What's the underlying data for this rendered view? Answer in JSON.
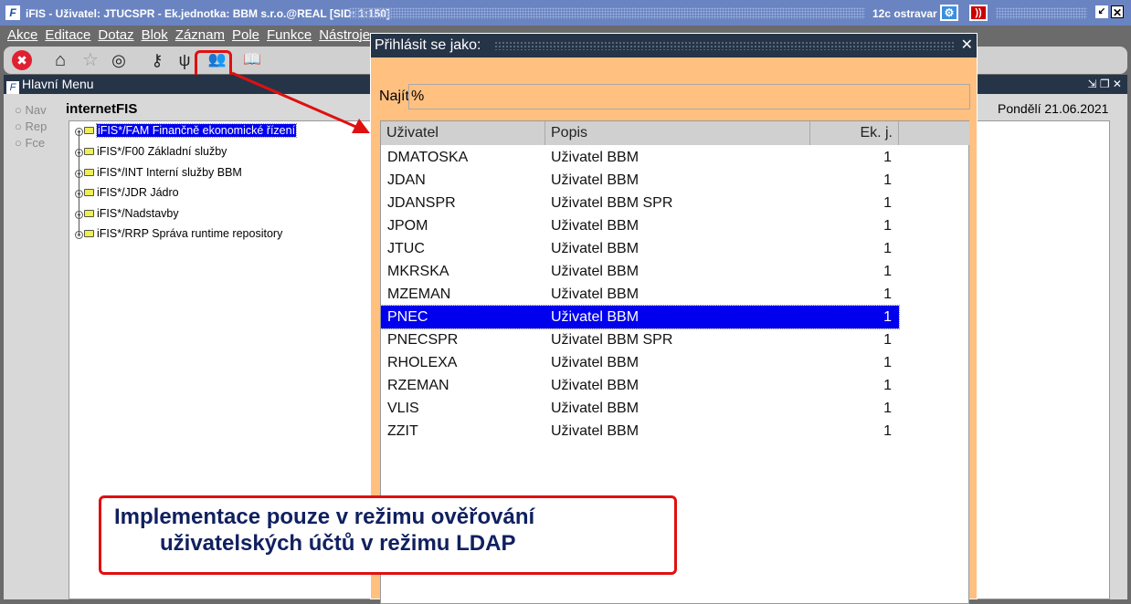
{
  "window": {
    "title": "iFIS - Uživatel: JTUCSPR - Ek.jednotka: BBM s.r.o.@REAL   [SID: 1:150]",
    "server": "12c ostravar"
  },
  "menu": [
    "Akce",
    "Editace",
    "Dotaz",
    "Blok",
    "Záznam",
    "Pole",
    "Funkce",
    "Nástroje"
  ],
  "toolbar": {
    "icons": [
      "close-icon",
      "home-icon",
      "star-icon",
      "compass-icon",
      "key-icon",
      "plug-icon",
      "users-icon",
      "book-user-icon"
    ]
  },
  "main_window": {
    "title": "Hlavní Menu",
    "heading": "internetFIS",
    "date": "Pondělí 21.06.2021",
    "radio": [
      "Nav",
      "Rep",
      "Fce"
    ],
    "tree": [
      "iFIS*/FAM Finančně ekonomické řízení",
      "iFIS*/F00 Základní služby",
      "iFIS*/INT Interní služby BBM",
      "iFIS*/JDR Jádro",
      "iFIS*/Nadstavby",
      "iFIS*/RRP Správa runtime repository"
    ]
  },
  "dialog": {
    "title": "Přihlásit se jako:",
    "find_label": "Najít",
    "find_value": "%",
    "columns": [
      "Uživatel",
      "Popis",
      "Ek. j."
    ],
    "selected_index": 7,
    "rows": [
      [
        "DMATOSKA",
        "Uživatel BBM",
        "1"
      ],
      [
        "JDAN",
        "Uživatel BBM",
        "1"
      ],
      [
        "JDANSPR",
        "Uživatel BBM SPR",
        "1"
      ],
      [
        "JPOM",
        "Uživatel BBM",
        "1"
      ],
      [
        "JTUC",
        "Uživatel BBM",
        "1"
      ],
      [
        "MKRSKA",
        "Uživatel BBM",
        "1"
      ],
      [
        "MZEMAN",
        "Uživatel BBM",
        "1"
      ],
      [
        "PNEC",
        "Uživatel BBM",
        "1"
      ],
      [
        "PNECSPR",
        "Uživatel BBM SPR",
        "1"
      ],
      [
        "RHOLEXA",
        "Uživatel BBM",
        "1"
      ],
      [
        "RZEMAN",
        "Uživatel BBM",
        "1"
      ],
      [
        "VLIS",
        "Uživatel BBM",
        "1"
      ],
      [
        "ZZIT",
        "Uživatel BBM",
        "1"
      ]
    ]
  },
  "annotation": {
    "line1": "Implementace pouze v režimu ověřování",
    "line2": "uživatelských účtů v režimu LDAP",
    "color": "#e01010"
  }
}
